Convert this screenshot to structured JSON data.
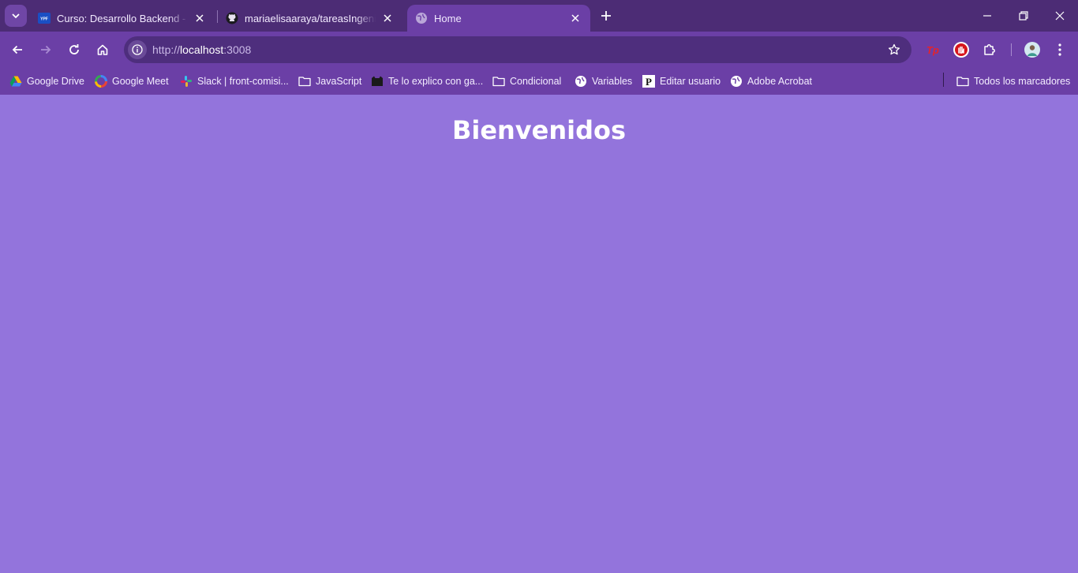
{
  "browser": {
    "tabs": [
      {
        "title": "Curso: Desarrollo Backend - Aula",
        "favicon": "ypf-favicon",
        "active": false
      },
      {
        "title": "mariaelisaaraya/tareasIngeniasA",
        "favicon": "github-favicon",
        "active": false
      },
      {
        "title": "Home",
        "favicon": "globe-favicon",
        "active": true
      }
    ],
    "address_bar": {
      "scheme": "http://",
      "host": "localhost",
      "port": ":3008"
    },
    "bookmarks": [
      {
        "label": "Google Drive",
        "icon": "google-drive-icon"
      },
      {
        "label": "Google Meet",
        "icon": "google-meet-icon"
      },
      {
        "label": "Slack | front-comisi...",
        "icon": "slack-icon"
      },
      {
        "label": "JavaScript",
        "icon": "folder-icon"
      },
      {
        "label": "Te lo explico con ga...",
        "icon": "cat-icon"
      },
      {
        "label": "Condicional",
        "icon": "folder-icon"
      },
      {
        "label": "Variables",
        "icon": "globe-icon"
      },
      {
        "label": "Editar usuario",
        "icon": "p-logo-icon"
      },
      {
        "label": "Adobe Acrobat",
        "icon": "globe-icon"
      }
    ],
    "all_bookmarks_label": "Todos los marcadores",
    "extensions": [
      "tp-extension-icon",
      "adblock-icon",
      "puzzle-extensions-icon",
      "profile-avatar"
    ],
    "colors": {
      "frame": "#4c2c75",
      "toolbar": "#6b3fa6",
      "omnibox": "#4e2e7d"
    }
  },
  "page": {
    "heading": "Bienvenidos",
    "background": "#9374dc"
  }
}
